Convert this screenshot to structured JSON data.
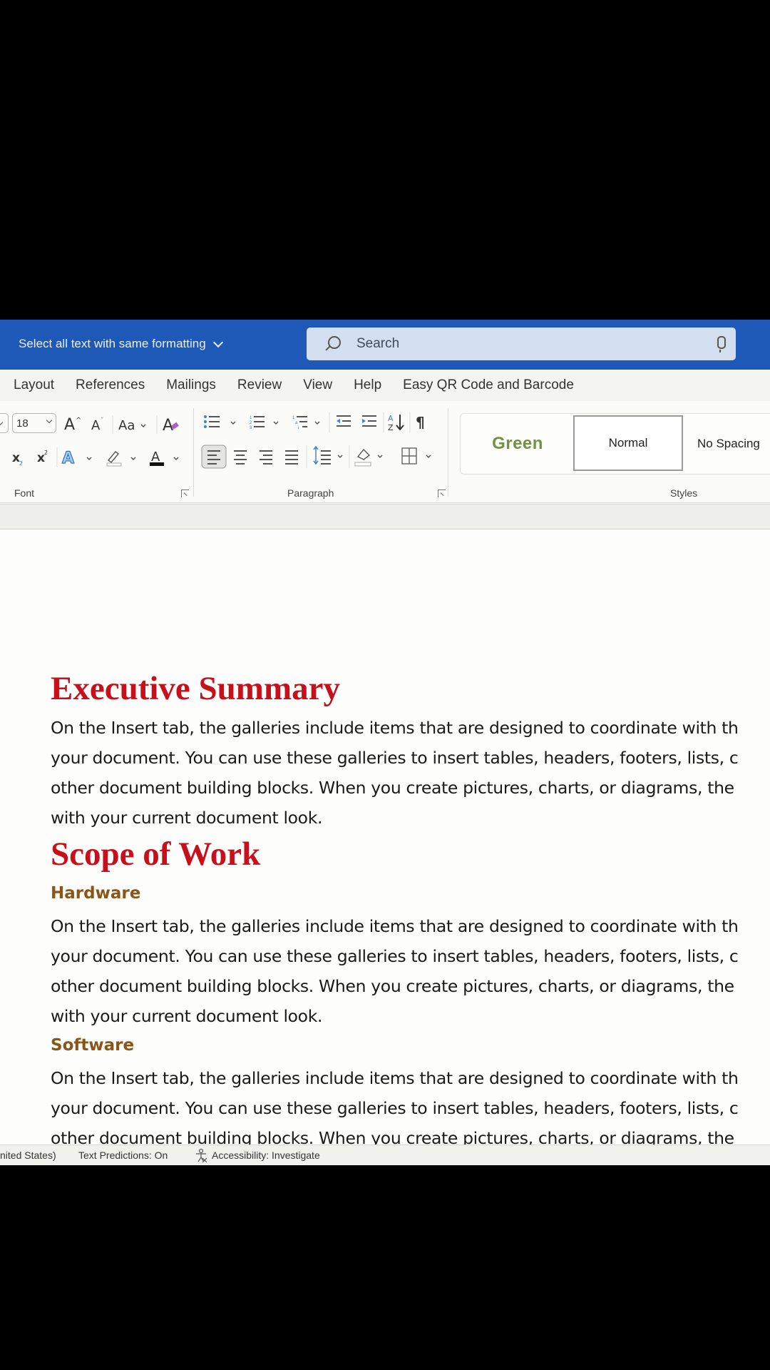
{
  "titlebar": {
    "command_dropdown": "Select all text with same formatting",
    "search_placeholder": "Search"
  },
  "tabs": [
    "Layout",
    "References",
    "Mailings",
    "Review",
    "View",
    "Help",
    "Easy QR Code and Barcode"
  ],
  "ribbon": {
    "font": {
      "size": "18",
      "group_label": "Font"
    },
    "paragraph": {
      "group_label": "Paragraph"
    },
    "styles": {
      "group_label": "Styles",
      "items": [
        "Green",
        "Normal",
        "No Spacing"
      ],
      "selected": "Normal",
      "green_color": "#6f9243"
    }
  },
  "document": {
    "sections": [
      {
        "heading": "Executive Summary",
        "lines": [
          "On the Insert tab, the galleries include items that are designed to coordinate with th",
          "your document. You can use these galleries to insert tables, headers, footers, lists, c",
          "other document building blocks. When you create pictures, charts, or diagrams, the",
          "with your current document look."
        ]
      },
      {
        "heading": "Scope of Work",
        "subsections": [
          {
            "heading": "Hardware",
            "lines": [
              "On the Insert tab, the galleries include items that are designed to coordinate with th",
              "your document. You can use these galleries to insert tables, headers, footers, lists, c",
              "other document building blocks. When you create pictures, charts, or diagrams, the",
              "with your current document look."
            ]
          },
          {
            "heading": "Software",
            "lines": [
              "On the Insert tab, the galleries include items that are designed to coordinate with th",
              "your document. You can use these galleries to insert tables, headers, footers, lists, c",
              "other document building blocks. When you create pictures, charts, or diagrams, the"
            ]
          }
        ]
      }
    ],
    "heading1_color": "#c8101c",
    "heading2_color": "#8b5516"
  },
  "statusbar": {
    "language": "nited States)",
    "text_predictions": "Text Predictions: On",
    "accessibility": "Accessibility: Investigate"
  }
}
